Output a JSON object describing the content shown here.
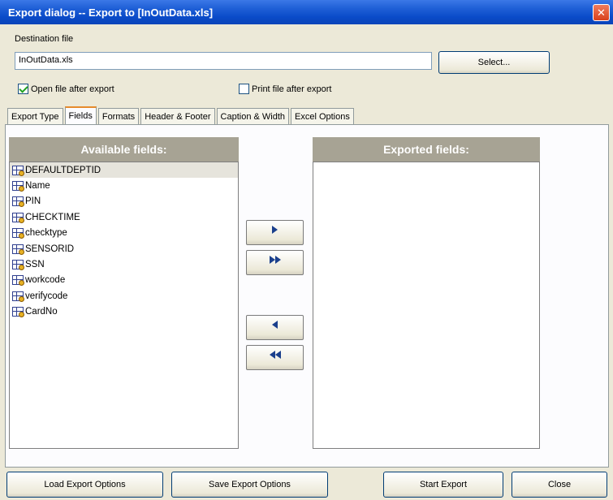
{
  "window": {
    "title": "Export dialog -- Export to [InOutData.xls]",
    "close_glyph": "✕"
  },
  "destination": {
    "label": "Destination file",
    "value": "InOutData.xls",
    "select_label": "Select..."
  },
  "options": {
    "open_after_export": {
      "label": "Open file after export",
      "checked": true
    },
    "print_after_export": {
      "label": "Print file after export",
      "checked": false
    }
  },
  "tabs": [
    {
      "label": "Export Type",
      "active": false
    },
    {
      "label": "Fields",
      "active": true
    },
    {
      "label": "Formats",
      "active": false
    },
    {
      "label": "Header & Footer",
      "active": false
    },
    {
      "label": "Caption & Width",
      "active": false
    },
    {
      "label": "Excel Options",
      "active": false
    }
  ],
  "available": {
    "header": "Available fields:",
    "items": [
      "DEFAULTDEPTID",
      "Name",
      "PIN",
      "CHECKTIME",
      "checktype",
      "SENSORID",
      "SSN",
      "workcode",
      "verifycode",
      "CardNo"
    ],
    "selected_index": 0
  },
  "exported": {
    "header": "Exported fields:",
    "items": []
  },
  "buttons": {
    "load": "Load Export Options",
    "save": "Save Export Options",
    "start": "Start Export",
    "close": "Close"
  },
  "icons": {
    "field_icon": "table-field-icon",
    "add": "arrow-right-icon",
    "add_all": "double-arrow-right-icon",
    "remove": "arrow-left-icon",
    "remove_all": "double-arrow-left-icon"
  },
  "colors": {
    "title_bar": "#0a4bc9",
    "list_header": "#a7a394",
    "dialog_bg": "#ece9d8",
    "active_tab_accent": "#e68b2c"
  }
}
